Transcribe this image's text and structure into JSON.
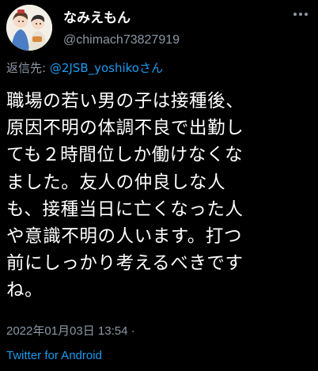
{
  "author": {
    "display_name": "なみえもん",
    "handle": "@chimach73827919",
    "avatar_icon": "avatar-illustration-icon"
  },
  "more_icon": "more-options-icon",
  "reply": {
    "prefix": "返信先: ",
    "mention": "@2JSB_yoshikoさん"
  },
  "body_lines": [
    "職場の若い男の子は接種後、",
    "原因不明の体調不良で出勤し",
    "ても２時間位しか働けなくな",
    "ました。友人の仲良しな人",
    "も、接種当日に亡くなった人",
    "や意識不明の人います。打つ",
    "前にしっかり考えるべきです",
    "ね。"
  ],
  "meta": {
    "timestamp": "2022年01月03日 13:54 ·"
  },
  "source": "Twitter for Android",
  "colors": {
    "background": "#000000",
    "text": "#ffffff",
    "secondary": "#8b98a5",
    "link": "#1d9bf0"
  }
}
